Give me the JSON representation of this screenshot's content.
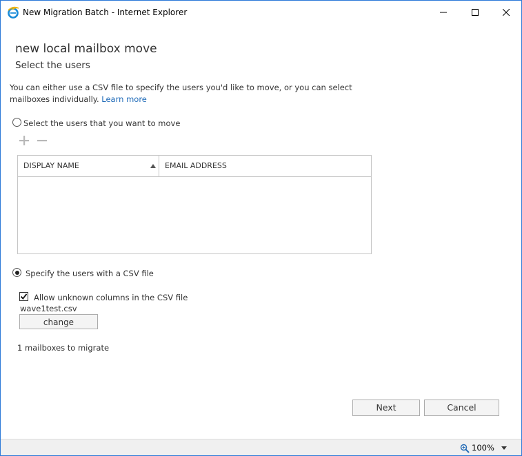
{
  "window": {
    "title": "New Migration Batch - Internet Explorer",
    "border_color": "#2b79d8"
  },
  "icons": {
    "browser": "ie-icon",
    "minimize": "minimize-icon",
    "maximize": "maximize-icon",
    "close": "close-icon",
    "add": "plus-icon",
    "remove": "minus-icon",
    "sort": "sort-up-icon",
    "zoom": "magnifier-icon",
    "zoom_menu": "chevron-down-icon"
  },
  "page": {
    "heading": "new local mailbox move",
    "subheading": "Select the users",
    "intro_text": "You can either use a CSV file to specify the users you'd like to move, or you can select mailboxes individually.",
    "learn_more": "Learn more",
    "link_color": "#1e6ab8"
  },
  "select_users": {
    "label": "Select the users that you want to move",
    "selected": false
  },
  "table": {
    "columns": [
      "DISPLAY NAME",
      "EMAIL ADDRESS"
    ],
    "sorted_column": "DISPLAY NAME",
    "rows": []
  },
  "csv_option": {
    "label": "Specify the users with a CSV file",
    "selected": true,
    "allow_unknown_label": "Allow unknown columns in the CSV file",
    "allow_unknown_checked": true,
    "filename": "wave1test.csv",
    "change_label": "change",
    "count_text": "1 mailboxes to migrate"
  },
  "footer": {
    "next_label": "Next",
    "cancel_label": "Cancel"
  },
  "statusbar": {
    "zoom": "100%"
  }
}
